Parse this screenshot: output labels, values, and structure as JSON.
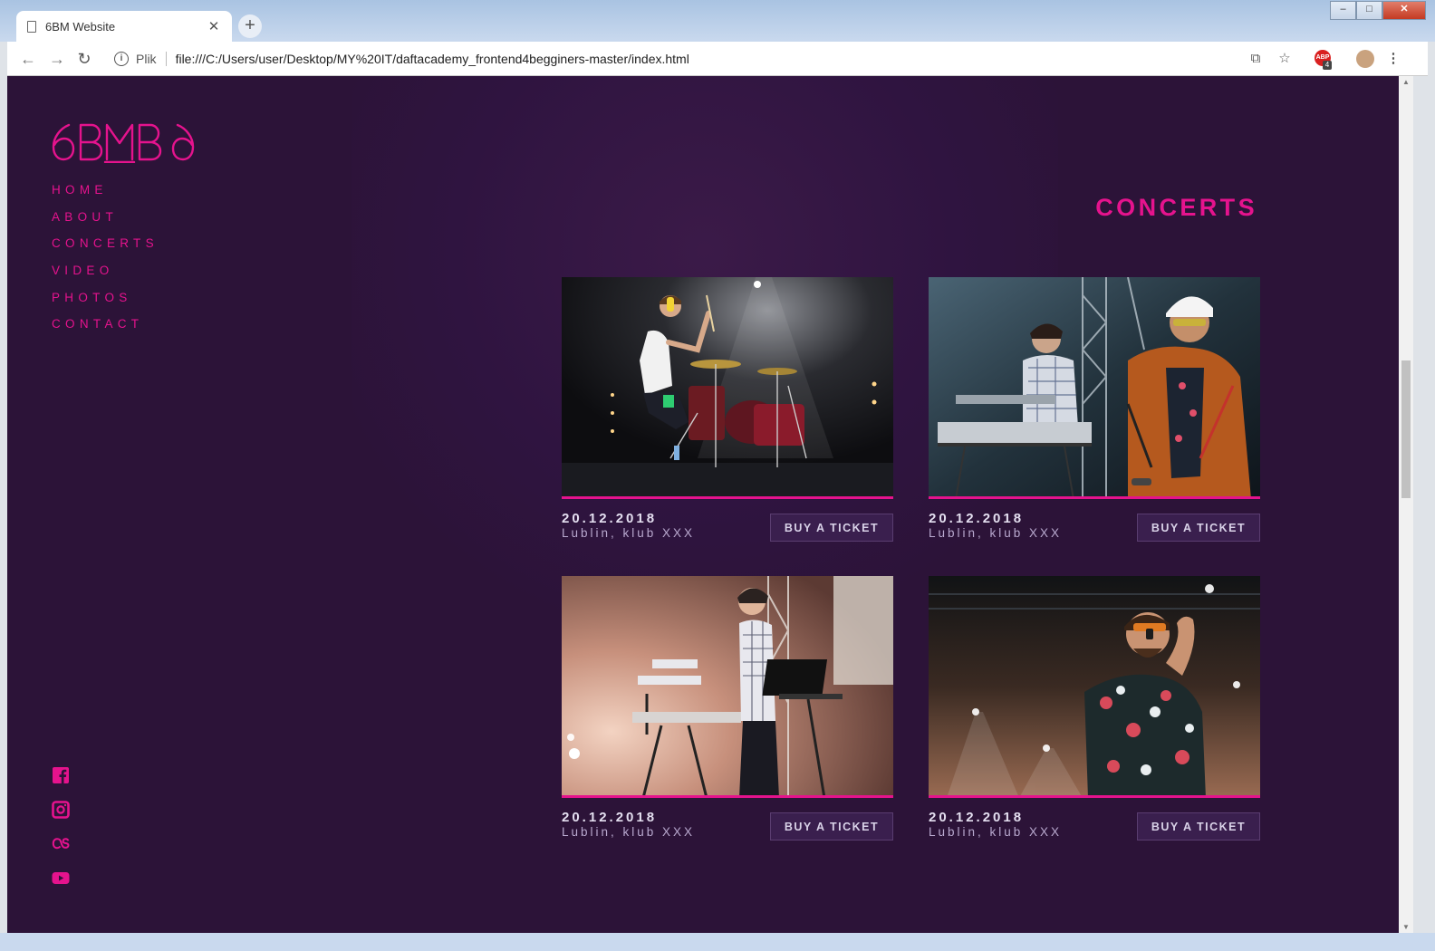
{
  "browser": {
    "tab_title": "6BM Website",
    "tab_close": "✕",
    "new_tab": "+",
    "scheme_label": "Plik",
    "url": "file:///C:/Users/user/Desktop/MY%20IT/daftacademy_frontend4begginers-master/index.html",
    "abp_badge": "4",
    "window_buttons": {
      "minimize": "–",
      "maximize": "□",
      "close": "✕"
    }
  },
  "page": {
    "logo_text": "6BM",
    "nav": [
      "HOME",
      "ABOUT",
      "CONCERTS",
      "VIDEO",
      "PHOTOS",
      "CONTACT"
    ],
    "social_icons": [
      "facebook-icon",
      "instagram-icon",
      "lastfm-icon",
      "youtube-icon"
    ],
    "heading": "CONCERTS",
    "concerts": [
      {
        "date": "20.12.2018",
        "place": "Lublin, klub XXX",
        "button": "BUY A TICKET",
        "photo": "drummer-on-stage"
      },
      {
        "date": "20.12.2018",
        "place": "Lublin, klub XXX",
        "button": "BUY A TICKET",
        "photo": "keyboardist-and-singer"
      },
      {
        "date": "20.12.2018",
        "place": "Lublin, klub XXX",
        "button": "BUY A TICKET",
        "photo": "keyboardist-with-laptop"
      },
      {
        "date": "20.12.2018",
        "place": "Lublin, klub XXX",
        "button": "BUY A TICKET",
        "photo": "singer-with-microphone"
      }
    ]
  },
  "colors": {
    "background": "#2c1338",
    "accent": "#e5138d",
    "button_bg": "#3a1f4e"
  }
}
